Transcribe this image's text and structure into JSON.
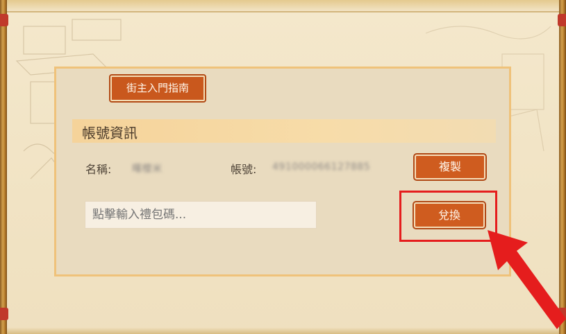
{
  "guide_button": {
    "label": "街主入門指南"
  },
  "section": {
    "title": "帳號資訊"
  },
  "account": {
    "name_label": "名稱:",
    "name_value": "曙櫻米",
    "id_label": "帳號:",
    "id_value": "491000066127885",
    "copy_label": "複製"
  },
  "gift_code": {
    "placeholder": "點擊輸入禮包碼...",
    "redeem_label": "兌換"
  },
  "colors": {
    "button_orange": "#cf5c1f",
    "highlight_red": "#e51d1d",
    "panel_border": "#efc27a"
  }
}
